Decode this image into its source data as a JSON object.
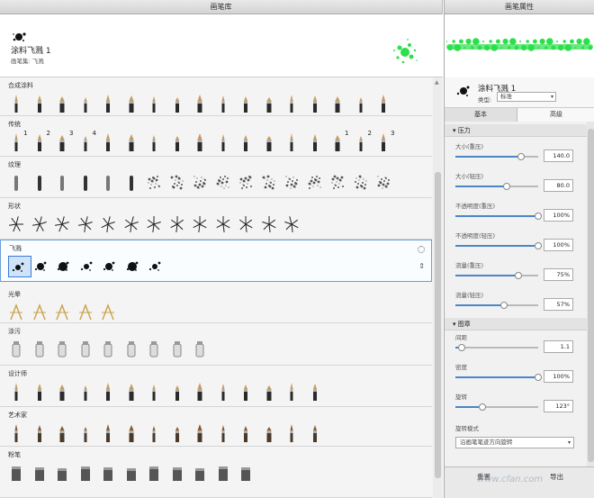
{
  "left_panel": {
    "title": "画笔库"
  },
  "preview": {
    "name": "涂料飞溅 1",
    "set": "画笔集: 飞溅"
  },
  "categories": [
    {
      "name": "合成涂料",
      "count": 17
    },
    {
      "name": "传统",
      "count": 17,
      "numbers": [
        "1",
        "2",
        "3",
        "4",
        "",
        "",
        "",
        "",
        "",
        "",
        "",
        "",
        "",
        "",
        "1",
        "2",
        "3"
      ]
    },
    {
      "name": "纹理",
      "count": 17
    },
    {
      "name": "形状",
      "count": 13
    },
    {
      "name": "飞溅",
      "count": 7
    },
    {
      "name": "光晕",
      "count": 5
    },
    {
      "name": "涂污",
      "count": 9
    },
    {
      "name": "设计师",
      "count": 14
    },
    {
      "name": "艺术家",
      "count": 14
    },
    {
      "name": "粉笔",
      "count": 11
    }
  ],
  "right_panel": {
    "title": "画笔属性",
    "brush_name": "涂料飞溅 1",
    "type_label": "类型:",
    "type_value": "标准",
    "tabs": [
      "基本",
      "高级"
    ],
    "sections": [
      "压力",
      "图章"
    ],
    "props": [
      {
        "label": "大小(重压)",
        "value": "140.0",
        "pct": 0.78
      },
      {
        "label": "大小(轻压)",
        "value": "80.0",
        "pct": 0.6
      },
      {
        "label": "不透明度(重压)",
        "value": "100%",
        "pct": 1.0
      },
      {
        "label": "不透明度(轻压)",
        "value": "100%",
        "pct": 1.0
      },
      {
        "label": "流量(重压)",
        "value": "75%",
        "pct": 0.75
      },
      {
        "label": "流量(轻压)",
        "value": "57%",
        "pct": 0.57
      },
      {
        "label": "间距",
        "value": "1.1",
        "pct": 0.03
      },
      {
        "label": "密度",
        "value": "100%",
        "pct": 1.0
      },
      {
        "label": "旋转",
        "value": "123°",
        "pct": 0.3
      }
    ],
    "rotate_mode_label": "旋转模式",
    "rotate_mode_value": "沿画笔笔迹方向旋转",
    "footer": {
      "reset": "重置",
      "export": "导出"
    }
  },
  "watermark": "www.cfan.com"
}
